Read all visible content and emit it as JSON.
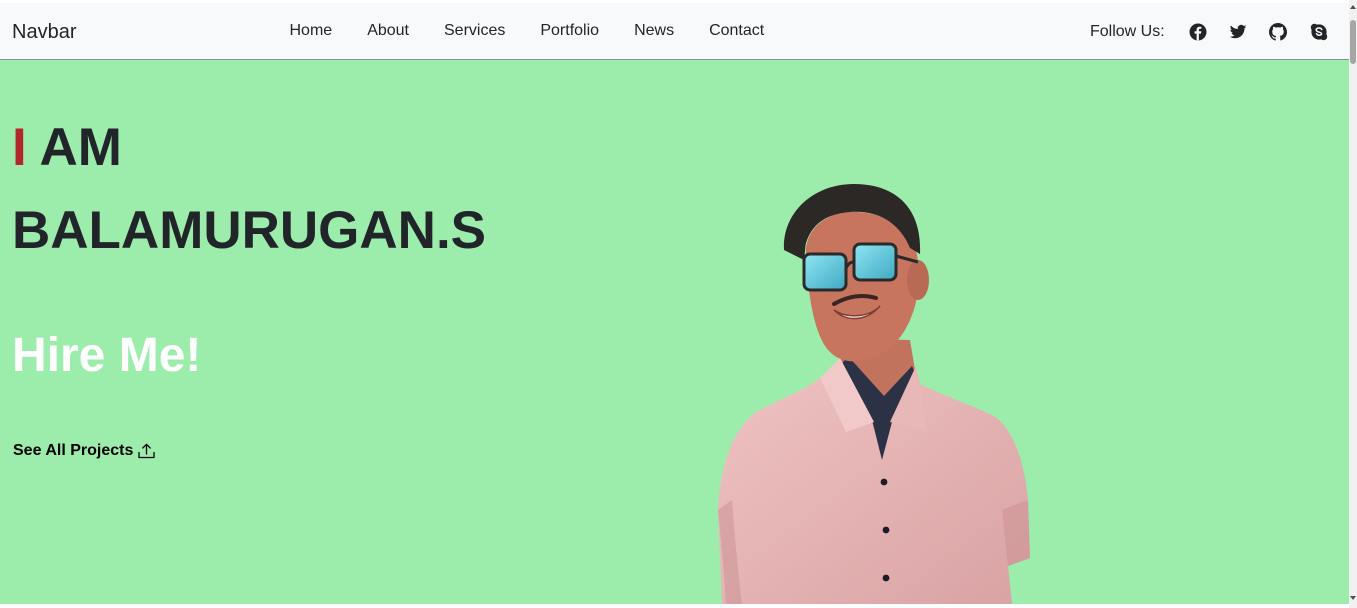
{
  "navbar": {
    "brand": "Navbar",
    "links": [
      "Home",
      "About",
      "Services",
      "Portfolio",
      "News",
      "Contact"
    ],
    "follow_label": "Follow Us:",
    "social_icons": [
      "facebook-icon",
      "twitter-icon",
      "github-icon",
      "skype-icon"
    ]
  },
  "hero": {
    "accent_letter": "I",
    "line1_rest": " AM",
    "line2": "BALAMURUGAN.S",
    "cta_heading": "Hire Me!",
    "projects_link": "See All Projects",
    "projects_icon": "upload-icon"
  },
  "colors": {
    "hero_background": "#9cedab",
    "accent_red": "#b3262c",
    "navbar_background": "#f8f9fa",
    "text_dark": "#212529"
  }
}
